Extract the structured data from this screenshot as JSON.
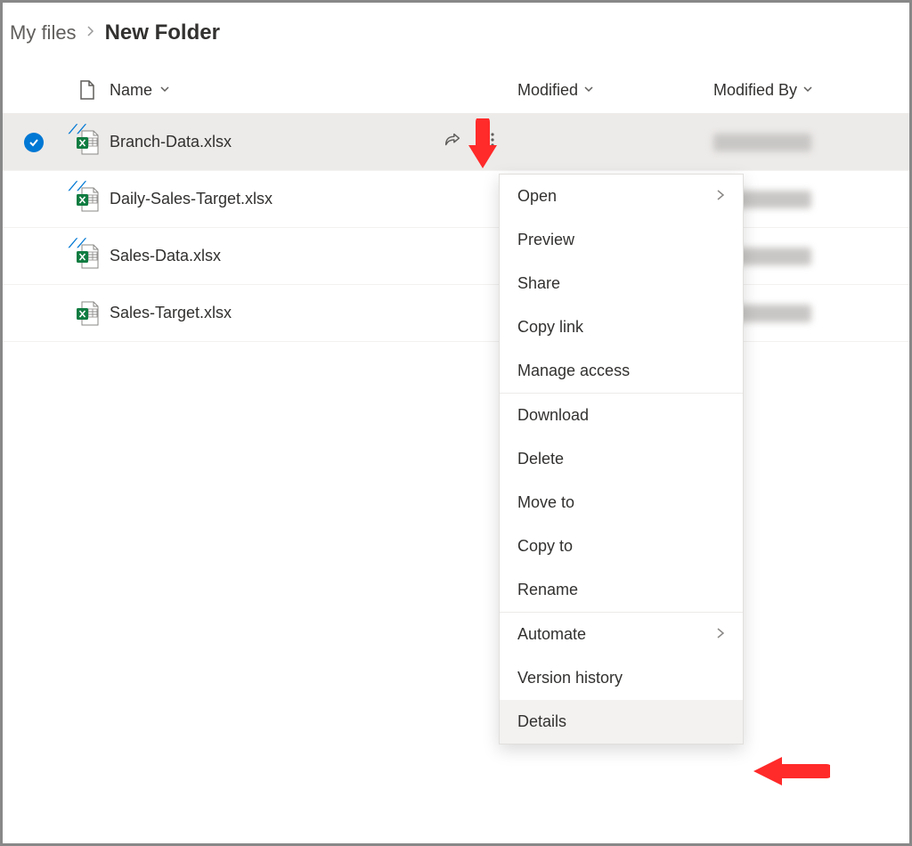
{
  "breadcrumb": {
    "root": "My files",
    "current": "New Folder"
  },
  "columns": {
    "name": "Name",
    "modified": "Modified",
    "modifiedBy": "Modified By"
  },
  "files": [
    {
      "name": "Branch-Data.xlsx",
      "selected": true,
      "syncing": true
    },
    {
      "name": "Daily-Sales-Target.xlsx",
      "selected": false,
      "syncing": true
    },
    {
      "name": "Sales-Data.xlsx",
      "selected": false,
      "syncing": true
    },
    {
      "name": "Sales-Target.xlsx",
      "selected": false,
      "syncing": false
    }
  ],
  "contextMenu": {
    "groups": [
      [
        {
          "label": "Open",
          "submenu": true
        },
        {
          "label": "Preview"
        },
        {
          "label": "Share"
        },
        {
          "label": "Copy link"
        },
        {
          "label": "Manage access"
        }
      ],
      [
        {
          "label": "Download"
        },
        {
          "label": "Delete"
        },
        {
          "label": "Move to"
        },
        {
          "label": "Copy to"
        },
        {
          "label": "Rename"
        }
      ],
      [
        {
          "label": "Automate",
          "submenu": true
        },
        {
          "label": "Version history"
        },
        {
          "label": "Details",
          "highlight": true
        }
      ]
    ]
  }
}
